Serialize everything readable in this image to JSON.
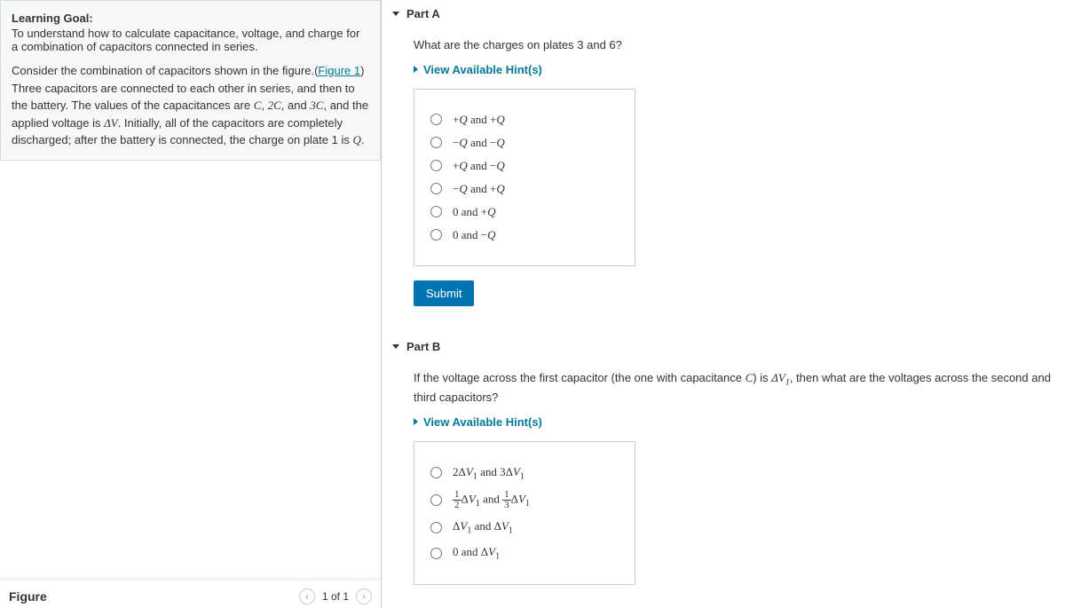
{
  "learning": {
    "title": "Learning Goal:",
    "goal": "To understand how to calculate capacitance, voltage, and charge for a combination of capacitors connected in series.",
    "desc_pre": "Consider the combination of capacitors shown in the figure.(",
    "figure_link": "Figure 1",
    "desc_post": ") Three capacitors are connected to each other in series, and then to the battery. The values of the capacitances are ",
    "caps": "C, 2C, and 3C",
    "desc_volt": ", and the applied voltage is ",
    "deltaV": "ΔV",
    "desc_init": ". Initially, all of the capacitors are completely discharged; after the battery is connected, the charge on plate 1 is ",
    "Q": "Q",
    "period": "."
  },
  "figure": {
    "label": "Figure",
    "pager": "1 of 1"
  },
  "partA": {
    "header": "Part A",
    "question": "What are the charges on plates 3 and 6?",
    "hints": "View Available Hint(s)",
    "options": [
      "+Q and +Q",
      "−Q and −Q",
      "+Q and −Q",
      "−Q and +Q",
      "0 and +Q",
      "0 and −Q"
    ],
    "submit": "Submit"
  },
  "partB": {
    "header": "Part B",
    "q_pre": "If the voltage across the first capacitor (the one with capacitance ",
    "C": "C",
    "q_mid": ") is ",
    "dv1": "ΔV₁",
    "q_post": ", then what are the voltages across the second and third capacitors?",
    "hints": "View Available Hint(s)",
    "options": {
      "o1": "2ΔV₁ and 3ΔV₁",
      "o2_a": "½ΔV₁",
      "o2_and": " and ",
      "o2_b": "⅓ΔV₁",
      "o3": "ΔV₁ and ΔV₁",
      "o4": "0 and ΔV₁"
    }
  }
}
